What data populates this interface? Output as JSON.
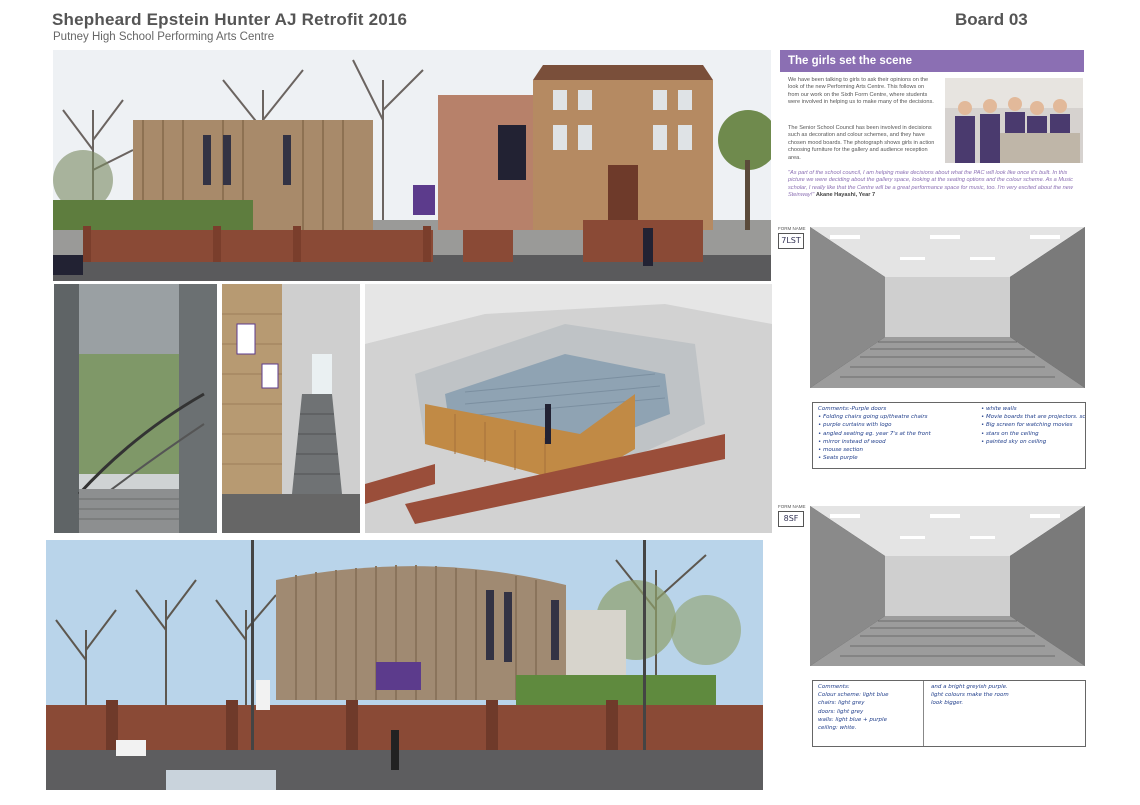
{
  "header": {
    "title": "Shepheard Epstein Hunter AJ Retrofit 2016",
    "subtitle": "Putney High School Performing Arts Centre",
    "board": "Board 03"
  },
  "scene": {
    "heading": "The girls set the scene",
    "para1": "We have been talking to girls to ask their opinions on the look of the new Performing Arts Centre. This follows on from our work on the Sixth Form Centre, where students were involved in helping us to make many of the decisions.",
    "para2": "The Senior School Council has been involved in decisions such as decoration and colour schemes, and they have chosen mood boards. The photograph shows girls in action choosing furniture for the gallery and audience reception area.",
    "quote": "\"As part of the school council, I am helping make decisions about what the PAC will look like once it's built. In this picture we were deciding about the gallery space, looking at the seating options and the colour scheme. As a Music scholar, I really like that the Centre will be a great performance space for music, too. I'm very excited about the new Steinway!\"",
    "quote_author": "Akane Hayashi, Year 7"
  },
  "forms": [
    {
      "label": "FORM NAME",
      "name": "7LST",
      "comments_left": [
        "Comments:-Purple doors",
        "• Folding chairs going up/theatre chairs",
        "• purple curtains with logo",
        "• angled seating eg. year 7's at the front",
        "• mirror instead of wood",
        "• mouse section",
        "• Seats purple"
      ],
      "comments_right": [
        "• white walls",
        "• Movie boards that are projectors. screens?",
        "• Big screen for watching movies",
        "• stars on the ceiling",
        "• painted sky on ceiling"
      ]
    },
    {
      "label": "FORM NAME",
      "name": "8SF",
      "comments_left": [
        "Comments:",
        "Colour scheme: light blue",
        "chairs: light grey",
        "doors: light grey",
        "walls: light blue + purple",
        "ceiling: white."
      ],
      "comments_right": [
        "and a bright greyish purple.",
        "light colours make the room",
        "look bigger."
      ]
    }
  ],
  "colors": {
    "accent": "#8b6fb3",
    "timber": "#a88a6a",
    "brick": "#8a4a36",
    "sky": "#e9eef2"
  }
}
